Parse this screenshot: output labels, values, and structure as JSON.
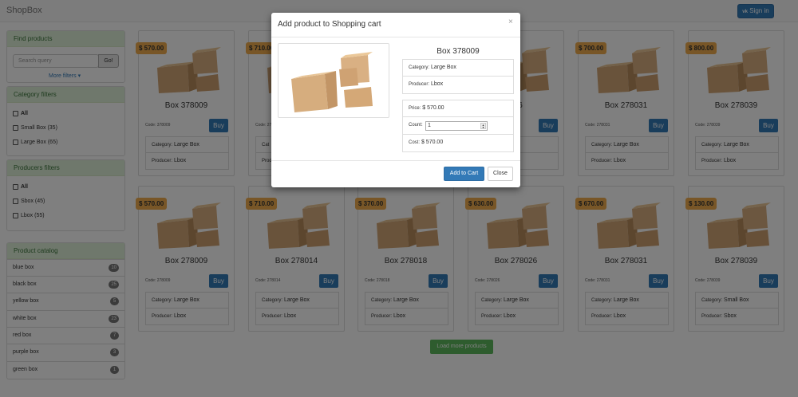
{
  "navbar": {
    "brand": "ShopBox",
    "signin_icon": "vk-icon",
    "signin_label": "Sign in"
  },
  "find_panel": {
    "title": "Find products",
    "search_placeholder": "Search query",
    "go_label": "Go!",
    "more_filters": "More filters"
  },
  "category_filters": {
    "title": "Category filters",
    "items": [
      {
        "label": "All"
      },
      {
        "label": "Small Box (35)"
      },
      {
        "label": "Large Box (65)"
      }
    ]
  },
  "producer_filters": {
    "title": "Producers filters",
    "items": [
      {
        "label": "All"
      },
      {
        "label": "Sbox (45)"
      },
      {
        "label": "Lbox (55)"
      }
    ]
  },
  "catalog": {
    "title": "Product catalog",
    "items": [
      {
        "label": "blue box",
        "count": "10"
      },
      {
        "label": "black box",
        "count": "25"
      },
      {
        "label": "yellow box",
        "count": "5"
      },
      {
        "label": "white box",
        "count": "23"
      },
      {
        "label": "red box",
        "count": "7"
      },
      {
        "label": "purple box",
        "count": "3"
      },
      {
        "label": "green box",
        "count": "1"
      }
    ]
  },
  "products": [
    {
      "price": "$ 570.00",
      "title": "Box 378009",
      "code": "Code: 378009",
      "buy": "Buy",
      "category_label": "Category:",
      "category": "Large Box",
      "producer_label": "Producer:",
      "producer": "Lbox"
    },
    {
      "price": "$ 710.00",
      "title": "",
      "code": "Code: 278014",
      "buy": "Buy",
      "category_label": "Cat",
      "category": "",
      "producer_label": "Prod",
      "producer": ""
    },
    {
      "price": "",
      "title": "",
      "code": "",
      "buy": "",
      "category_label": "",
      "category": "",
      "producer_label": "",
      "producer": ""
    },
    {
      "price": "",
      "title": "026",
      "code": "",
      "buy": "Buy",
      "category_label": "",
      "category": "Box",
      "producer_label": "",
      "producer": ""
    },
    {
      "price": "$ 700.00",
      "title": "Box 278031",
      "code": "Code: 278031",
      "buy": "Buy",
      "category_label": "Category:",
      "category": "Large Box",
      "producer_label": "Producer:",
      "producer": "Lbox"
    },
    {
      "price": "$ 800.00",
      "title": "Box 278039",
      "code": "Code: 278039",
      "buy": "Buy",
      "category_label": "Category:",
      "category": "Large Box",
      "producer_label": "Producer:",
      "producer": "Lbox"
    },
    {
      "price": "$ 570.00",
      "title": "Box 278009",
      "code": "Code: 278009",
      "buy": "Buy",
      "category_label": "Category:",
      "category": "Large Box",
      "producer_label": "Producer:",
      "producer": "Lbox"
    },
    {
      "price": "$ 710.00",
      "title": "Box 278014",
      "code": "Code: 278014",
      "buy": "Buy",
      "category_label": "Category:",
      "category": "Large Box",
      "producer_label": "Producer:",
      "producer": "Lbox"
    },
    {
      "price": "$ 370.00",
      "title": "Box 278018",
      "code": "Code: 278018",
      "buy": "Buy",
      "category_label": "Category:",
      "category": "Large Box",
      "producer_label": "Producer:",
      "producer": "Lbox"
    },
    {
      "price": "$ 630.00",
      "title": "Box 278026",
      "code": "Code: 278026",
      "buy": "Buy",
      "category_label": "Category:",
      "category": "Large Box",
      "producer_label": "Producer:",
      "producer": "Lbox"
    },
    {
      "price": "$ 670.00",
      "title": "Box 278031",
      "code": "Code: 278031",
      "buy": "Buy",
      "category_label": "Category:",
      "category": "Large Box",
      "producer_label": "Producer:",
      "producer": "Lbox"
    },
    {
      "price": "$ 130.00",
      "title": "Box 278039",
      "code": "Code: 278039",
      "buy": "Buy",
      "category_label": "Category:",
      "category": "Small Box",
      "producer_label": "Producer:",
      "producer": "Sbox"
    }
  ],
  "load_more": "Load more products",
  "modal": {
    "title": "Add product to Shopping cart",
    "close_icon": "×",
    "product_name": "Box 378009",
    "category_label": "Category:",
    "category": "Large Box",
    "producer_label": "Producer:",
    "producer": "Lbox",
    "price_label": "Price:",
    "price": "$ 570.00",
    "count_label": "Count:",
    "count": "1",
    "cost_label": "Cost:",
    "cost": "$ 570.00",
    "add_label": "Add to Cart",
    "close_label": "Close"
  },
  "colors": {
    "primary": "#337ab7",
    "success": "#5cb85c",
    "price_tag": "#f0ad4e",
    "panel_heading": "#dff0d8"
  }
}
